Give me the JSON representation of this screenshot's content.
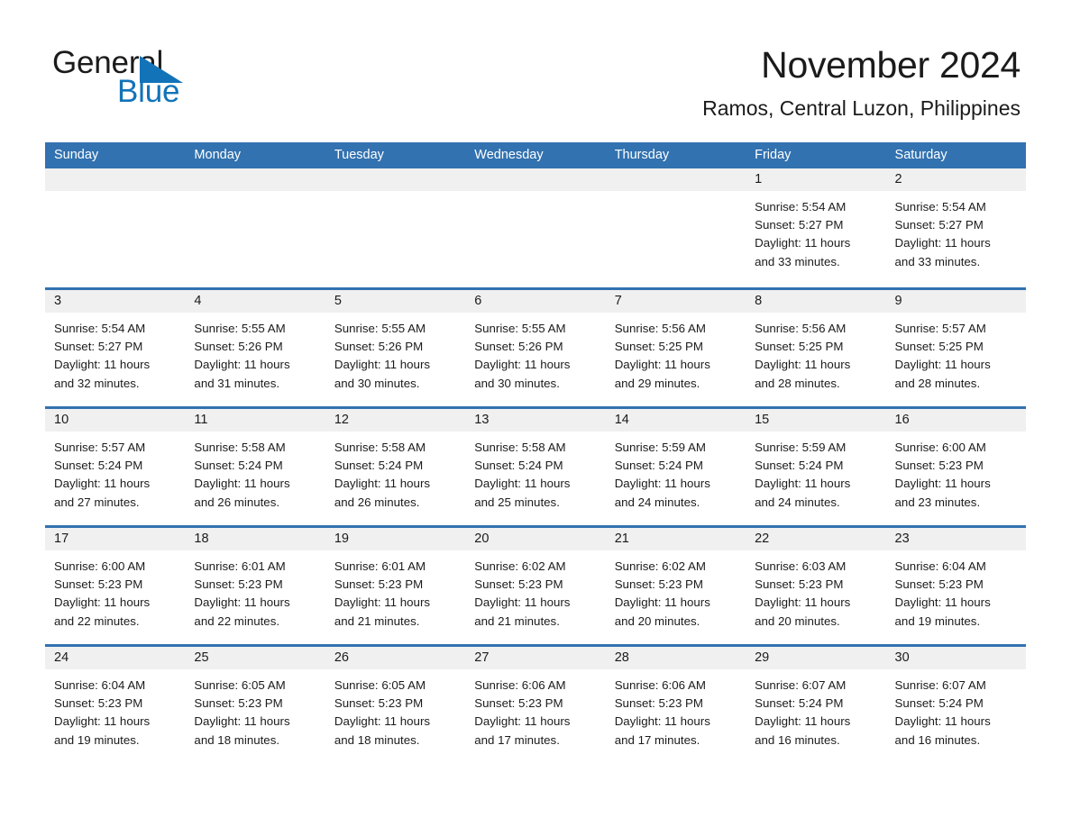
{
  "logo": {
    "word_one": "General",
    "word_two": "Blue",
    "triangle_icon": "triangle-icon",
    "brand_blue": "#1273b8"
  },
  "header": {
    "month_title": "November 2024",
    "location": "Ramos, Central Luzon, Philippines"
  },
  "colors": {
    "header_blue": "#3272b0",
    "day_band_gray": "#f0f0f0",
    "text": "#1b1b1b"
  },
  "weekdays": [
    "Sunday",
    "Monday",
    "Tuesday",
    "Wednesday",
    "Thursday",
    "Friday",
    "Saturday"
  ],
  "weeks": [
    [
      {
        "day": "",
        "sunrise": "",
        "sunset": "",
        "daylight_line1": "",
        "daylight_line2": ""
      },
      {
        "day": "",
        "sunrise": "",
        "sunset": "",
        "daylight_line1": "",
        "daylight_line2": ""
      },
      {
        "day": "",
        "sunrise": "",
        "sunset": "",
        "daylight_line1": "",
        "daylight_line2": ""
      },
      {
        "day": "",
        "sunrise": "",
        "sunset": "",
        "daylight_line1": "",
        "daylight_line2": ""
      },
      {
        "day": "",
        "sunrise": "",
        "sunset": "",
        "daylight_line1": "",
        "daylight_line2": ""
      },
      {
        "day": "1",
        "sunrise": "Sunrise: 5:54 AM",
        "sunset": "Sunset: 5:27 PM",
        "daylight_line1": "Daylight: 11 hours",
        "daylight_line2": "and 33 minutes."
      },
      {
        "day": "2",
        "sunrise": "Sunrise: 5:54 AM",
        "sunset": "Sunset: 5:27 PM",
        "daylight_line1": "Daylight: 11 hours",
        "daylight_line2": "and 33 minutes."
      }
    ],
    [
      {
        "day": "3",
        "sunrise": "Sunrise: 5:54 AM",
        "sunset": "Sunset: 5:27 PM",
        "daylight_line1": "Daylight: 11 hours",
        "daylight_line2": "and 32 minutes."
      },
      {
        "day": "4",
        "sunrise": "Sunrise: 5:55 AM",
        "sunset": "Sunset: 5:26 PM",
        "daylight_line1": "Daylight: 11 hours",
        "daylight_line2": "and 31 minutes."
      },
      {
        "day": "5",
        "sunrise": "Sunrise: 5:55 AM",
        "sunset": "Sunset: 5:26 PM",
        "daylight_line1": "Daylight: 11 hours",
        "daylight_line2": "and 30 minutes."
      },
      {
        "day": "6",
        "sunrise": "Sunrise: 5:55 AM",
        "sunset": "Sunset: 5:26 PM",
        "daylight_line1": "Daylight: 11 hours",
        "daylight_line2": "and 30 minutes."
      },
      {
        "day": "7",
        "sunrise": "Sunrise: 5:56 AM",
        "sunset": "Sunset: 5:25 PM",
        "daylight_line1": "Daylight: 11 hours",
        "daylight_line2": "and 29 minutes."
      },
      {
        "day": "8",
        "sunrise": "Sunrise: 5:56 AM",
        "sunset": "Sunset: 5:25 PM",
        "daylight_line1": "Daylight: 11 hours",
        "daylight_line2": "and 28 minutes."
      },
      {
        "day": "9",
        "sunrise": "Sunrise: 5:57 AM",
        "sunset": "Sunset: 5:25 PM",
        "daylight_line1": "Daylight: 11 hours",
        "daylight_line2": "and 28 minutes."
      }
    ],
    [
      {
        "day": "10",
        "sunrise": "Sunrise: 5:57 AM",
        "sunset": "Sunset: 5:24 PM",
        "daylight_line1": "Daylight: 11 hours",
        "daylight_line2": "and 27 minutes."
      },
      {
        "day": "11",
        "sunrise": "Sunrise: 5:58 AM",
        "sunset": "Sunset: 5:24 PM",
        "daylight_line1": "Daylight: 11 hours",
        "daylight_line2": "and 26 minutes."
      },
      {
        "day": "12",
        "sunrise": "Sunrise: 5:58 AM",
        "sunset": "Sunset: 5:24 PM",
        "daylight_line1": "Daylight: 11 hours",
        "daylight_line2": "and 26 minutes."
      },
      {
        "day": "13",
        "sunrise": "Sunrise: 5:58 AM",
        "sunset": "Sunset: 5:24 PM",
        "daylight_line1": "Daylight: 11 hours",
        "daylight_line2": "and 25 minutes."
      },
      {
        "day": "14",
        "sunrise": "Sunrise: 5:59 AM",
        "sunset": "Sunset: 5:24 PM",
        "daylight_line1": "Daylight: 11 hours",
        "daylight_line2": "and 24 minutes."
      },
      {
        "day": "15",
        "sunrise": "Sunrise: 5:59 AM",
        "sunset": "Sunset: 5:24 PM",
        "daylight_line1": "Daylight: 11 hours",
        "daylight_line2": "and 24 minutes."
      },
      {
        "day": "16",
        "sunrise": "Sunrise: 6:00 AM",
        "sunset": "Sunset: 5:23 PM",
        "daylight_line1": "Daylight: 11 hours",
        "daylight_line2": "and 23 minutes."
      }
    ],
    [
      {
        "day": "17",
        "sunrise": "Sunrise: 6:00 AM",
        "sunset": "Sunset: 5:23 PM",
        "daylight_line1": "Daylight: 11 hours",
        "daylight_line2": "and 22 minutes."
      },
      {
        "day": "18",
        "sunrise": "Sunrise: 6:01 AM",
        "sunset": "Sunset: 5:23 PM",
        "daylight_line1": "Daylight: 11 hours",
        "daylight_line2": "and 22 minutes."
      },
      {
        "day": "19",
        "sunrise": "Sunrise: 6:01 AM",
        "sunset": "Sunset: 5:23 PM",
        "daylight_line1": "Daylight: 11 hours",
        "daylight_line2": "and 21 minutes."
      },
      {
        "day": "20",
        "sunrise": "Sunrise: 6:02 AM",
        "sunset": "Sunset: 5:23 PM",
        "daylight_line1": "Daylight: 11 hours",
        "daylight_line2": "and 21 minutes."
      },
      {
        "day": "21",
        "sunrise": "Sunrise: 6:02 AM",
        "sunset": "Sunset: 5:23 PM",
        "daylight_line1": "Daylight: 11 hours",
        "daylight_line2": "and 20 minutes."
      },
      {
        "day": "22",
        "sunrise": "Sunrise: 6:03 AM",
        "sunset": "Sunset: 5:23 PM",
        "daylight_line1": "Daylight: 11 hours",
        "daylight_line2": "and 20 minutes."
      },
      {
        "day": "23",
        "sunrise": "Sunrise: 6:04 AM",
        "sunset": "Sunset: 5:23 PM",
        "daylight_line1": "Daylight: 11 hours",
        "daylight_line2": "and 19 minutes."
      }
    ],
    [
      {
        "day": "24",
        "sunrise": "Sunrise: 6:04 AM",
        "sunset": "Sunset: 5:23 PM",
        "daylight_line1": "Daylight: 11 hours",
        "daylight_line2": "and 19 minutes."
      },
      {
        "day": "25",
        "sunrise": "Sunrise: 6:05 AM",
        "sunset": "Sunset: 5:23 PM",
        "daylight_line1": "Daylight: 11 hours",
        "daylight_line2": "and 18 minutes."
      },
      {
        "day": "26",
        "sunrise": "Sunrise: 6:05 AM",
        "sunset": "Sunset: 5:23 PM",
        "daylight_line1": "Daylight: 11 hours",
        "daylight_line2": "and 18 minutes."
      },
      {
        "day": "27",
        "sunrise": "Sunrise: 6:06 AM",
        "sunset": "Sunset: 5:23 PM",
        "daylight_line1": "Daylight: 11 hours",
        "daylight_line2": "and 17 minutes."
      },
      {
        "day": "28",
        "sunrise": "Sunrise: 6:06 AM",
        "sunset": "Sunset: 5:23 PM",
        "daylight_line1": "Daylight: 11 hours",
        "daylight_line2": "and 17 minutes."
      },
      {
        "day": "29",
        "sunrise": "Sunrise: 6:07 AM",
        "sunset": "Sunset: 5:24 PM",
        "daylight_line1": "Daylight: 11 hours",
        "daylight_line2": "and 16 minutes."
      },
      {
        "day": "30",
        "sunrise": "Sunrise: 6:07 AM",
        "sunset": "Sunset: 5:24 PM",
        "daylight_line1": "Daylight: 11 hours",
        "daylight_line2": "and 16 minutes."
      }
    ]
  ]
}
